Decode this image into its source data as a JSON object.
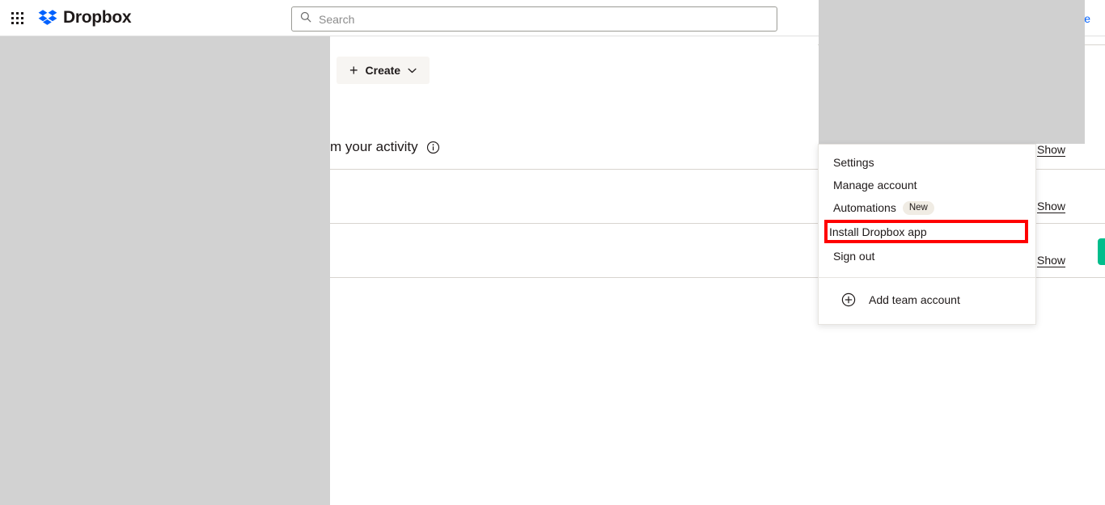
{
  "header": {
    "app_grid_icon": "app-grid-icon",
    "brand_name": "Dropbox",
    "brand_logo_icon": "dropbox-logo-icon",
    "search": {
      "icon": "search-icon",
      "placeholder": "Search",
      "value": ""
    },
    "right_cut_text": "e"
  },
  "main": {
    "create_button": {
      "plus_icon": "plus-icon",
      "label": "Create",
      "chevron_icon": "chevron-down-icon"
    },
    "activity_text": "m your activity",
    "activity_info_icon": "info-circle-icon",
    "show_links": [
      {
        "label": "Show"
      },
      {
        "label": "Show"
      },
      {
        "label": "Show"
      }
    ]
  },
  "account_menu": {
    "items": [
      {
        "label": "Settings",
        "badge": "",
        "highlighted": false
      },
      {
        "label": "Manage account",
        "badge": "",
        "highlighted": false
      },
      {
        "label": "Automations",
        "badge": "New",
        "highlighted": false
      },
      {
        "label": "Install Dropbox app",
        "badge": "",
        "highlighted": true
      },
      {
        "label": "Sign out",
        "badge": "",
        "highlighted": false
      }
    ],
    "footer": {
      "icon": "circle-plus-icon",
      "label": "Add team account"
    }
  },
  "overlays": {
    "left_block_label": "dimmed-left-region",
    "top_right_block_label": "dimmed-top-right-region",
    "green_tab_label": "side-feedback-tab"
  },
  "colors": {
    "brand_blue": "#0061fe",
    "highlight_red": "#ff0000",
    "badge_bg": "#f0ece4",
    "create_bg": "#f7f5f2",
    "gray_overlay": "#d2d2d2",
    "green_tab": "#00bd8c"
  }
}
